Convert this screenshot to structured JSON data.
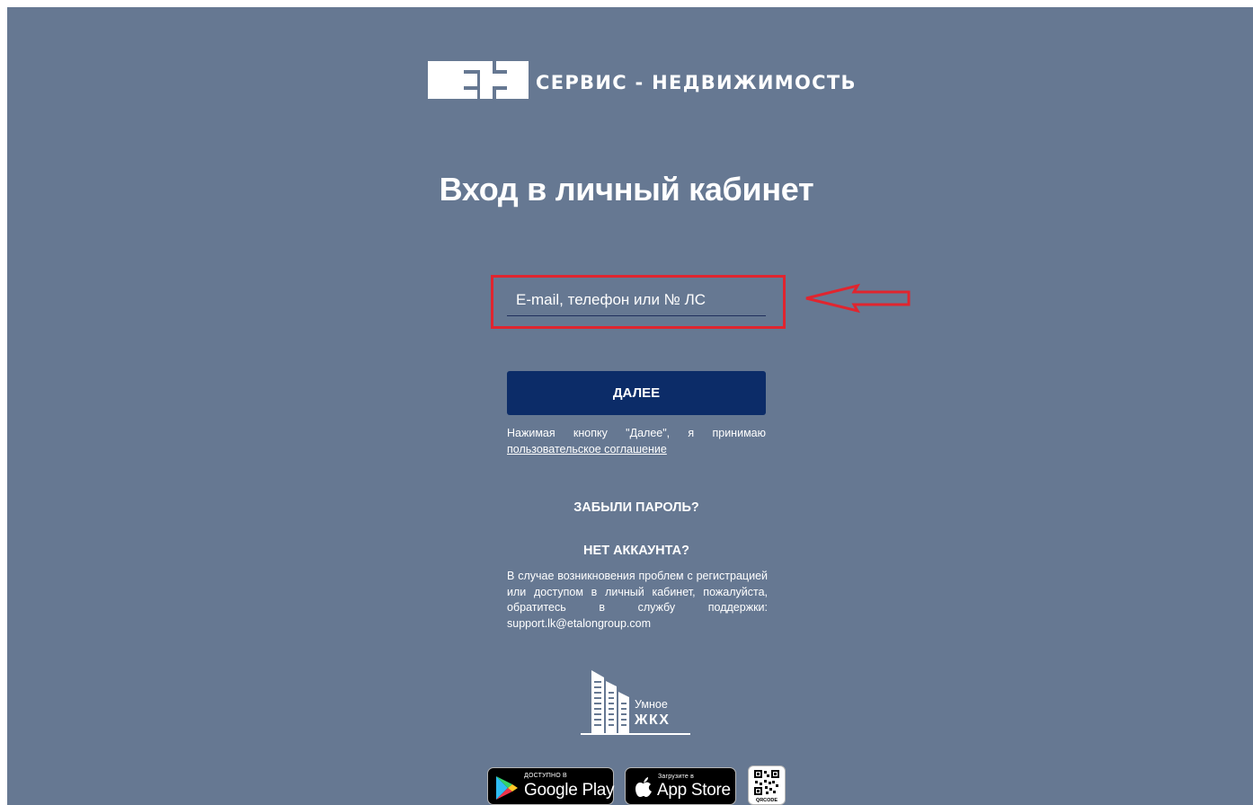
{
  "brand": {
    "name": "СЕРВИС - НЕДВИЖИМОСТЬ",
    "logo_icon": "sn-logo-icon",
    "accent_color": "#0c2c68",
    "background_color": "#667892",
    "highlight_color": "#e0252f"
  },
  "page": {
    "title": "Вход в личный кабинет"
  },
  "login_form": {
    "input_placeholder": "E-mail, телефон или № ЛС",
    "input_value": "",
    "next_label": "ДАЛЕЕ",
    "agreement_text": "Нажимая кнопку \"Далее\", я принимаю",
    "agreement_link": "пользовательское соглашение",
    "forgot_password": "ЗАБЫЛИ ПАРОЛЬ?",
    "no_account": "НЕТ АККАУНТА?",
    "support_text": "В случае возникновения проблем с регистрацией или доступом в личный кабинет, пожалуйста, обратитесь в службу поддержки: support.lk@etalongroup.com"
  },
  "annotation": {
    "arrow_icon": "red-arrow-left-icon"
  },
  "smart_logo": {
    "icon": "buildings-icon",
    "line1": "Умное",
    "line2": "ЖКХ"
  },
  "stores": {
    "google_small": "ДОСТУПНО В",
    "google_big": "Google Play",
    "apple_small": "Загрузите в",
    "apple_big": "App Store",
    "qr_label": "QRCODE"
  }
}
